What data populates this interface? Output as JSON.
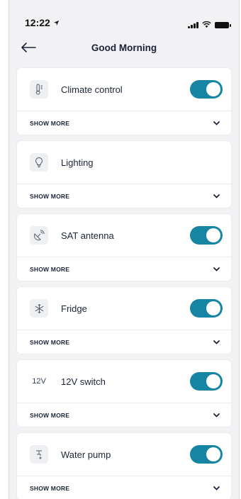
{
  "status": {
    "time": "12:22"
  },
  "header": {
    "title": "Good Morning"
  },
  "cards": [
    {
      "title": "Climate control",
      "icon": "thermometer-icon",
      "toggle": true,
      "show_more": "SHOW MORE"
    },
    {
      "title": "Lighting",
      "icon": "lightbulb-icon",
      "toggle": false,
      "show_more": "SHOW MORE"
    },
    {
      "title": "SAT antenna",
      "icon": "satellite-dish-icon",
      "toggle": true,
      "show_more": "SHOW MORE"
    },
    {
      "title": "Fridge",
      "icon": "snowflake-icon",
      "toggle": true,
      "show_more": "SHOW MORE"
    },
    {
      "title": "12V switch",
      "icon": "12v-label-icon",
      "icon_text": "12V",
      "toggle": true,
      "show_more": "SHOW MORE"
    },
    {
      "title": "Water pump",
      "icon": "faucet-icon",
      "toggle": true,
      "show_more": "SHOW MORE"
    }
  ],
  "colors": {
    "accent": "#1685a4",
    "background": "#f2f2f4",
    "card": "#ffffff",
    "text": "#1c2438"
  }
}
